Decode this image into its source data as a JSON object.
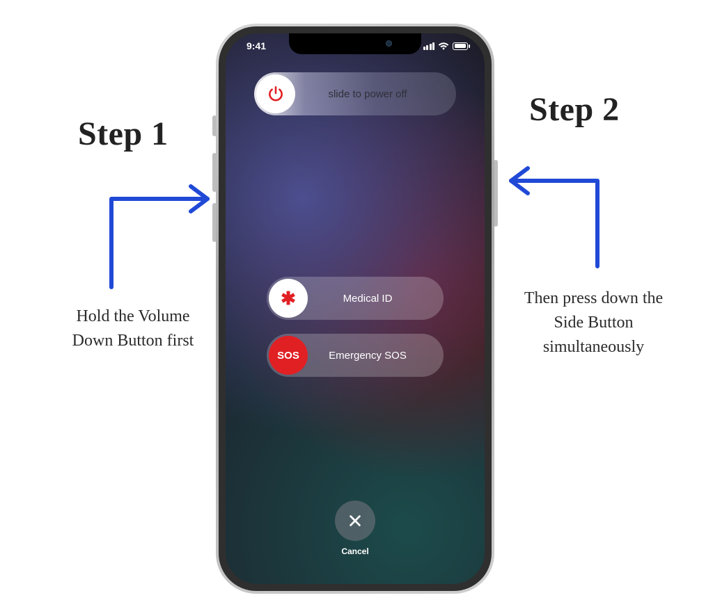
{
  "status": {
    "time": "9:41"
  },
  "sliders": {
    "power": "slide to power off",
    "medical": "Medical ID",
    "sos_knob": "SOS",
    "sos_label": "Emergency SOS",
    "medical_symbol": "✱"
  },
  "cancel": {
    "label": "Cancel"
  },
  "steps": {
    "s1": {
      "title": "Step 1",
      "body": "Hold the Volume Down Button first"
    },
    "s2": {
      "title": "Step 2",
      "body": "Then press down the Side Button simultaneously"
    }
  },
  "colors": {
    "arrow": "#2049d6",
    "power_red": "#e12024",
    "med_red": "#e12024"
  }
}
